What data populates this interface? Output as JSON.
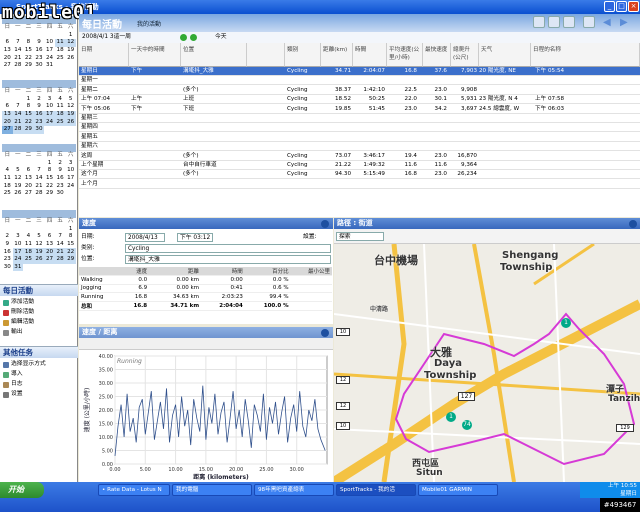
{
  "window": {
    "title": "SportTracks - 我的活動"
  },
  "logo": {
    "text": "mobile01"
  },
  "watermark": {
    "text": "#493467"
  },
  "calendar": {
    "weekdays": [
      "日",
      "一",
      "二",
      "三",
      "四",
      "五",
      "六"
    ],
    "months": [
      {
        "label": "",
        "rows": [
          [
            "",
            "",
            "",
            "",
            "",
            "",
            "1"
          ],
          [
            "6",
            "7",
            "8",
            "9",
            "10",
            "11",
            "12"
          ],
          [
            "13",
            "14",
            "15",
            "16",
            "17",
            "18",
            "19"
          ],
          [
            "20",
            "21",
            "22",
            "23",
            "24",
            "25",
            "26"
          ],
          [
            "27",
            "28",
            "29",
            "30",
            "31",
            "",
            ""
          ]
        ]
      },
      {
        "label": "",
        "rows": [
          [
            "",
            "",
            "1",
            "2",
            "3",
            "4",
            "5"
          ],
          [
            "6",
            "7",
            "8",
            "9",
            "10",
            "11",
            "12"
          ],
          [
            "13",
            "14",
            "15",
            "16",
            "17",
            "18",
            "19"
          ],
          [
            "20",
            "21",
            "22",
            "23",
            "24",
            "25",
            "26"
          ],
          [
            "27",
            "28",
            "29",
            "30",
            "",
            "",
            ""
          ]
        ]
      },
      {
        "label": "",
        "rows": [
          [
            "",
            "",
            "",
            "",
            "1",
            "2",
            "3"
          ],
          [
            "4",
            "5",
            "6",
            "7",
            "8",
            "9",
            "10"
          ],
          [
            "11",
            "12",
            "13",
            "14",
            "15",
            "16",
            "17"
          ],
          [
            "18",
            "19",
            "20",
            "21",
            "22",
            "23",
            "24"
          ],
          [
            "25",
            "26",
            "27",
            "28",
            "29",
            "30",
            ""
          ]
        ]
      },
      {
        "label": "",
        "rows": [
          [
            "",
            "",
            "",
            "",
            "",
            "",
            "1"
          ],
          [
            "2",
            "3",
            "4",
            "5",
            "6",
            "7",
            "8"
          ],
          [
            "9",
            "10",
            "11",
            "12",
            "13",
            "14",
            "15"
          ],
          [
            "16",
            "17",
            "18",
            "19",
            "20",
            "21",
            "22"
          ],
          [
            "23",
            "24",
            "25",
            "26",
            "27",
            "28",
            "29"
          ],
          [
            "30",
            "31",
            "",
            "",
            "",
            "",
            ""
          ]
        ]
      }
    ]
  },
  "daily": {
    "title": "每日活動",
    "items": [
      "添加活動",
      "刪除活動",
      "編輯活動",
      "輸出"
    ]
  },
  "other": {
    "title": "其他任务",
    "items": [
      "选择显示方式",
      "導入",
      "日志",
      "设置"
    ]
  },
  "main": {
    "title": "每日活動",
    "subtitle": "我的活動",
    "period": "2008/4/1 3這一周",
    "today": "今天",
    "columns": [
      "日期",
      "一天中的時間",
      "位置",
      "",
      "類别",
      "距離(km)",
      "時間",
      "平均速度(公里/小時)",
      "最快速度",
      "總爬升(公尺)",
      "天气",
      "熱量",
      "日程的名称"
    ],
    "rows": [
      {
        "date": "星期日",
        "time": "下午",
        "loc": "溝墘抖_大雅",
        "cat": "Cycling",
        "dist": "34.71",
        "dur": "2:04:07",
        "avg": "16.8",
        "max": "37.6",
        "cal": "7,903",
        "weather": "20 陽光度, NE",
        "name": "下午 05:54",
        "sel": true
      },
      {
        "date": "星期一"
      },
      {
        "date": "星期二",
        "loc": "(多个)",
        "cat": "Cycling",
        "dist": "38.37",
        "dur": "1:42:10",
        "avg": "22.5",
        "max": "23.0",
        "cal": "9,908"
      },
      {
        "date": "上午 07:04",
        "time": "上午",
        "loc": "上班",
        "cat": "Cycling",
        "dist": "18.52",
        "dur": "50:25",
        "avg": "22.0",
        "max": "30.1",
        "cal": "5,931",
        "weather": "23 陽光度, N 4",
        "name": "上午 07:58"
      },
      {
        "date": "下午 05:06",
        "time": "下午",
        "loc": "下班",
        "cat": "Cycling",
        "dist": "19.85",
        "dur": "51:45",
        "avg": "23.0",
        "max": "34.2",
        "cal": "3,697",
        "weather": "24.5 總雲度, W",
        "name": "下午 06:03"
      },
      {
        "date": "星期三"
      },
      {
        "date": "星期四"
      },
      {
        "date": "星期五"
      },
      {
        "date": "星期六"
      },
      {
        "date": "这周",
        "loc": "(多个)",
        "cat": "Cycling",
        "dist": "73.07",
        "dur": "3:46:17",
        "avg": "19.4",
        "max": "23.0",
        "cal": "16,870"
      },
      {
        "date": "上个星期",
        "loc": "台中自行車道",
        "cat": "Cycling",
        "dist": "21.22",
        "dur": "1:49:32",
        "avg": "11.6",
        "max": "11.6",
        "cal": "9,364"
      },
      {
        "date": "这个月",
        "loc": "(多个)",
        "cat": "Cycling",
        "dist": "94.30",
        "dur": "5:15:49",
        "avg": "16.8",
        "max": "23.0",
        "cal": "26,234"
      },
      {
        "date": "上个月"
      }
    ]
  },
  "speed": {
    "title": "速度",
    "date_label": "日期:",
    "date": "2008/4/13",
    "time": "下午 03:12",
    "settings": "設置:",
    "cat_label": "类别:",
    "cat": "Cycling",
    "loc_label": "位置:",
    "loc": "溝墘抖_大雅",
    "cols": [
      "",
      "速度",
      "距離",
      "時間",
      "百分比",
      "最小公里"
    ],
    "rows": [
      [
        "Walking",
        "0.0",
        "0.00 km",
        "0:00",
        "0.0 %",
        ""
      ],
      [
        "Jogging",
        "6.9",
        "0.00 km",
        "0:41",
        "0.6 %",
        ""
      ],
      [
        "Running",
        "16.8",
        "34.63 km",
        "2:03:23",
        "99.4 %",
        ""
      ]
    ],
    "total": [
      "总和",
      "16.8",
      "34.71 km",
      "2:04:04",
      "100.0 %",
      ""
    ]
  },
  "chartpanel": {
    "title": "速度 / 距离"
  },
  "chart_data": {
    "type": "line",
    "title": "",
    "series_label": "Running",
    "xlabel": "距离 (kilometers)",
    "ylabel": "速度 (公里/小時)",
    "xlim": [
      0,
      35
    ],
    "ylim": [
      0,
      40
    ],
    "xticks": [
      "0.00",
      "5.00",
      "10.00",
      "15.00",
      "20.00",
      "25.00",
      "30.00"
    ],
    "yticks": [
      "0.00",
      "5.00",
      "10.00",
      "15.00",
      "20.00",
      "25.00",
      "30.00",
      "35.00",
      "40.00"
    ],
    "series": [
      {
        "x": [
          0,
          0.5,
          1,
          1.5,
          2,
          2.5,
          3,
          3.5,
          4,
          4.5,
          5,
          5.5,
          6,
          6.5,
          7,
          7.5,
          8,
          8.5,
          9,
          9.5,
          10,
          10.5,
          11,
          11.5,
          12,
          12.5,
          13,
          13.5,
          14,
          14.5,
          15,
          15.5,
          16,
          16.5,
          17,
          17.5,
          18,
          18.5,
          19,
          19.5,
          20,
          20.5,
          21,
          21.5,
          22,
          22.5,
          23,
          23.5,
          24,
          24.5,
          25,
          25.5,
          26,
          26.5,
          27,
          27.5,
          28,
          28.5,
          29,
          29.5,
          30,
          30.5,
          31,
          31.5,
          32,
          32.5,
          33,
          33.5,
          34,
          34.7
        ],
        "y": [
          3,
          14,
          22,
          10,
          26,
          12,
          17,
          8,
          21,
          24,
          11,
          19,
          27,
          9,
          16,
          23,
          13,
          28,
          8,
          18,
          22,
          10,
          25,
          14,
          20,
          7,
          24,
          17,
          12,
          29,
          9,
          21,
          15,
          26,
          11,
          19,
          23,
          8,
          17,
          27,
          13,
          20,
          10,
          24,
          16,
          6,
          22,
          18,
          12,
          26,
          9,
          21,
          15,
          23,
          11,
          19,
          25,
          8,
          17,
          22,
          12,
          27,
          14,
          10,
          20,
          16,
          24,
          13,
          9,
          5
        ]
      }
    ]
  },
  "map": {
    "title": "路徑 : 街道",
    "search": "探索",
    "labels": [
      "台中機場",
      "Shengang",
      "Township",
      "大雅",
      "Daya",
      "Township",
      "潭子",
      "Tanzih",
      "西屯區",
      "Situn",
      "中清路"
    ],
    "roads": [
      "127",
      "74",
      "1",
      "1",
      "10",
      "12",
      "12",
      "10",
      "129"
    ]
  },
  "taskbar": {
    "start": "开始",
    "buttons": [
      "• Rate Data - Lotus N",
      "我的電腦",
      "98年黑吧資產總表",
      "SportTracks - 我的活",
      "Mobile01 GARMIN"
    ],
    "time": "上午 10:55",
    "day": "星期日"
  }
}
